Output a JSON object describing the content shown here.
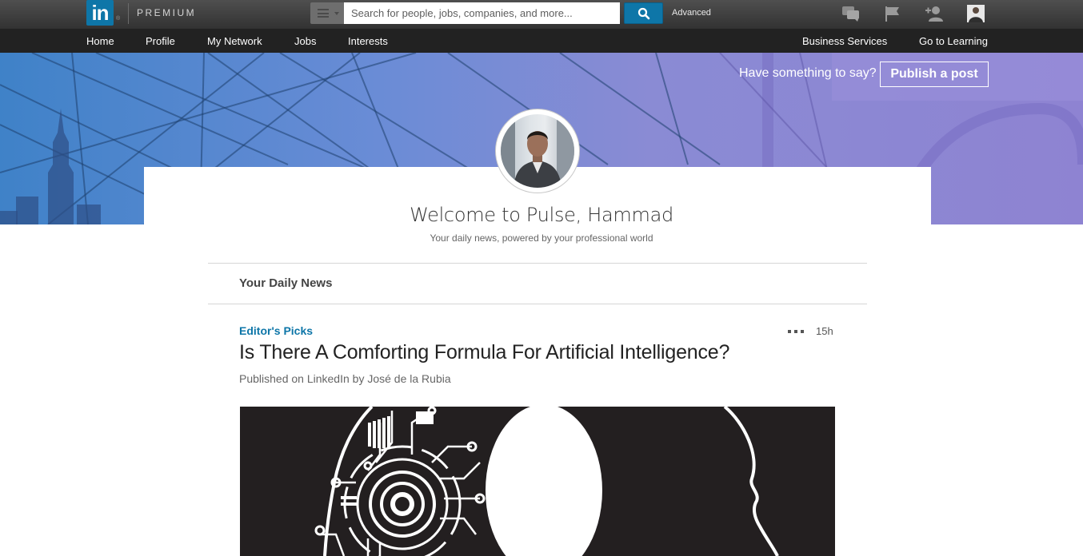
{
  "topbar": {
    "logo_text": "in",
    "logo_mark": "®",
    "brand_tier": "PREMIUM",
    "search": {
      "placeholder": "Search for people, jobs, companies, and more...",
      "value": ""
    },
    "advanced_label": "Advanced",
    "icons": [
      "messages-icon",
      "notifications-flag-icon",
      "add-connections-icon",
      "profile-avatar-icon"
    ]
  },
  "nav": {
    "left": [
      "Home",
      "Profile",
      "My Network",
      "Jobs",
      "Interests"
    ],
    "right": [
      "Business Services",
      "Go to Learning"
    ]
  },
  "hero": {
    "prompt": "Have something to say?",
    "publish_label": "Publish a post"
  },
  "welcome": {
    "title": "Welcome to Pulse, Hammad",
    "subtitle": "Your daily news, powered by your professional world"
  },
  "feed": {
    "section_title": "Your Daily News",
    "article": {
      "category": "Editor's Picks",
      "age": "15h",
      "title": "Is There A Comforting Formula For Artificial Intelligence?",
      "byline": "Published on LinkedIn by José de la Rubia"
    }
  },
  "colors": {
    "brand_blue": "#0e76a8",
    "topbar": "#3f3f3f",
    "navbar": "#222222",
    "hero_left": "#3f82c8",
    "hero_right": "#8e83d2"
  }
}
